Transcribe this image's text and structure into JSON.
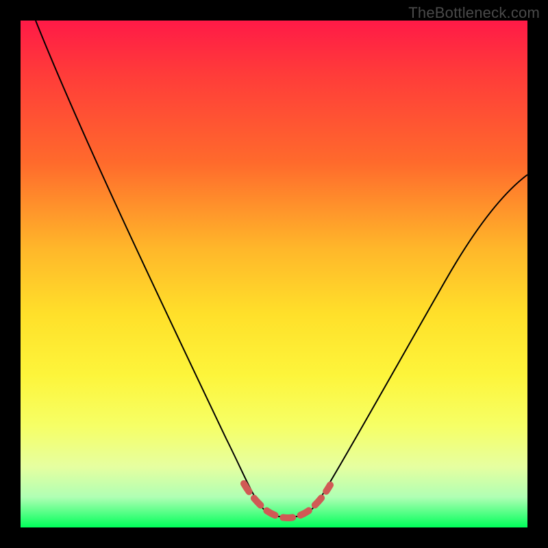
{
  "watermark": "TheBottleneck.com",
  "colors": {
    "gradient_top": "#ff1a47",
    "gradient_mid": "#ffe02a",
    "gradient_bottom": "#00ff5a",
    "curve": "#000000",
    "valley_dash": "#d05a55",
    "frame": "#000000"
  },
  "chart_data": {
    "type": "line",
    "title": "",
    "xlabel": "",
    "ylabel": "",
    "xlim": [
      0,
      100
    ],
    "ylim": [
      0,
      100
    ],
    "grid": false,
    "legend": false,
    "note": "Axes are unlabeled in source; values below are estimated positions on a 0–100 normalized scale, top-left origin visual.",
    "series": [
      {
        "name": "bottleneck-curve",
        "x": [
          3,
          10,
          20,
          30,
          38,
          43,
          46,
          49,
          55,
          58,
          62,
          70,
          80,
          90,
          100
        ],
        "y": [
          0,
          18,
          42,
          65,
          83,
          92,
          96,
          98,
          98,
          96,
          92,
          80,
          63,
          46,
          31
        ]
      }
    ],
    "annotations": [
      {
        "name": "valley-highlight",
        "style": "dashed",
        "color": "#d05a55",
        "x": [
          43,
          46,
          49,
          52,
          55,
          58
        ],
        "y": [
          92,
          96,
          98,
          98,
          96,
          92
        ]
      }
    ]
  }
}
